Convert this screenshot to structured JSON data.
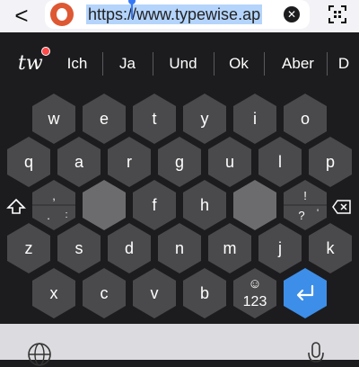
{
  "browser": {
    "back_glyph": "<",
    "url": "https://www.typewise.ap",
    "clear_glyph": "✕"
  },
  "suggestions": [
    "Ich",
    "Ja",
    "Und",
    "Ok",
    "Aber",
    "D"
  ],
  "logo_text": "tw",
  "keyboard": {
    "row1": [
      "w",
      "e",
      "t",
      "y",
      "i",
      "o"
    ],
    "row2": [
      "q",
      "a",
      "r",
      "g",
      "u",
      "l",
      "p"
    ],
    "row3_keys": [
      "f",
      "h"
    ],
    "punct_left_top": ",",
    "punct_left_bottom_a": ".",
    "punct_left_bottom_b": ":",
    "punct_right_top": "!",
    "punct_right_bottom_a": "?",
    "punct_right_bottom_b": "'",
    "row4": [
      "z",
      "s",
      "d",
      "n",
      "m",
      "j",
      "k"
    ],
    "row5": [
      "x",
      "c",
      "v",
      "b"
    ],
    "numbers_label": "123",
    "emoji_glyph": "☺",
    "return_glyph": "⏎"
  },
  "colors": {
    "key": "#4a4a4c",
    "key_light": "#6c6c6e",
    "return_key": "#3d8ee8",
    "background": "#1c1c1e",
    "url_selection": "#b4d4fb"
  }
}
